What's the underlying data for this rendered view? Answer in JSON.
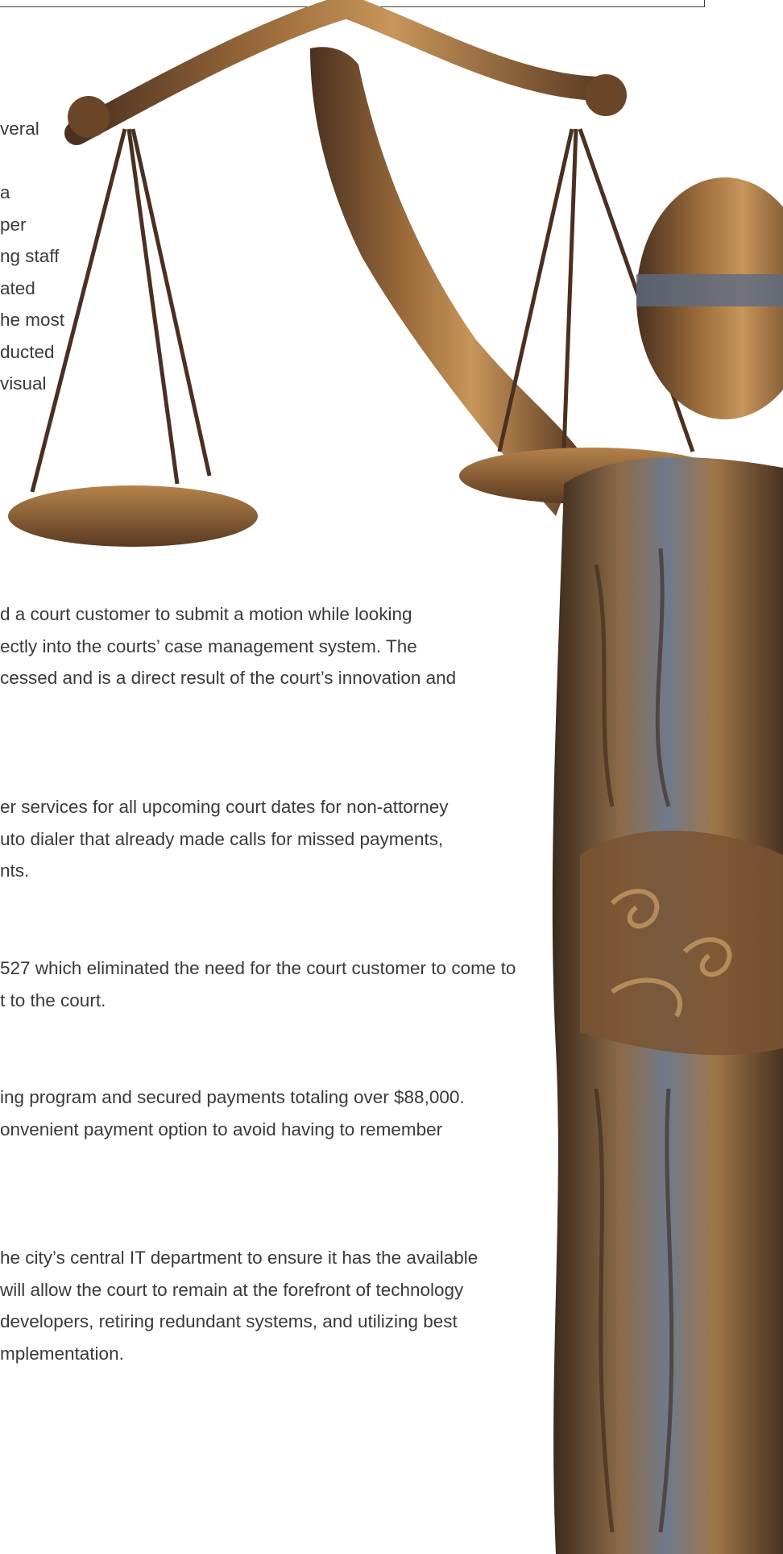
{
  "figure": {
    "subject": "justice-statue-with-scales"
  },
  "paragraphs": [
    {
      "lines": [
        "veral",
        "",
        "a",
        "per",
        "ng staff",
        "ated",
        "he most",
        "ducted",
        "visual"
      ]
    },
    {
      "lines": [
        "d a court customer to submit a motion while looking",
        "ectly into the courts’ case management system.  The",
        "cessed and is a direct result of the court’s innovation and"
      ]
    },
    {
      "lines": [
        "er services for all upcoming court dates for non-attorney",
        "uto dialer that already made calls for missed payments,",
        "nts."
      ]
    },
    {
      "lines": [
        "527 which eliminated the need for the court customer to come to",
        "t to the court."
      ]
    },
    {
      "lines": [
        "ing program and secured payments totaling over $88,000.",
        "onvenient payment option to avoid having to remember"
      ]
    },
    {
      "lines": [
        "he city’s central IT department to ensure it has the available",
        "will allow the court to remain at the forefront of technology",
        "developers, retiring redundant systems, and utilizing best",
        "mplementation."
      ]
    }
  ]
}
